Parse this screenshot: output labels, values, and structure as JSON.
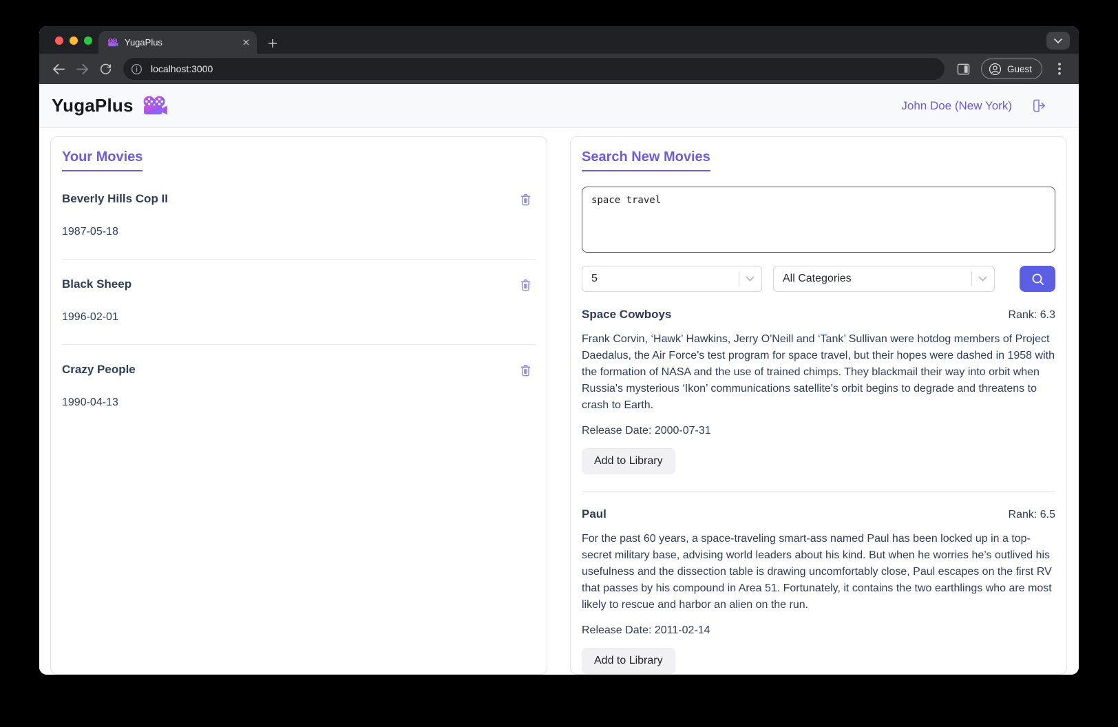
{
  "colors": {
    "accent_purple": "#6d5be0",
    "icon_purple": "#8f84ef",
    "search_button": "#5b5fe3",
    "text_dark": "#2e3d59",
    "chrome_bg": "#202124",
    "chrome_surface": "#36373b"
  },
  "browser": {
    "tab_title": "YugaPlus",
    "url": "localhost:3000",
    "guest_label": "Guest"
  },
  "header": {
    "app_title": "YugaPlus",
    "user_name": "John Doe (New York)"
  },
  "library": {
    "title": "Your Movies",
    "movies": [
      {
        "title": "Beverly Hills Cop II",
        "date": "1987-05-18"
      },
      {
        "title": "Black Sheep",
        "date": "1996-02-01"
      },
      {
        "title": "Crazy People",
        "date": "1990-04-13"
      }
    ]
  },
  "search": {
    "title": "Search New Movies",
    "query": "space travel",
    "limit_value": "5",
    "category_value": "All Categories",
    "results": [
      {
        "title": "Space Cowboys",
        "rank_label": "Rank: 6.3",
        "description": "Frank Corvin, ‘Hawk’ Hawkins, Jerry O'Neill and ‘Tank’ Sullivan were hotdog members of Project Daedalus, the Air Force's test program for space travel, but their hopes were dashed in 1958 with the formation of NASA and the use of trained chimps. They blackmail their way into orbit when Russia's mysterious ‘Ikon’ communications satellite's orbit begins to degrade and threatens to crash to Earth.",
        "release_label": "Release Date: 2000-07-31",
        "add_label": "Add to Library"
      },
      {
        "title": "Paul",
        "rank_label": "Rank: 6.5",
        "description": "For the past 60 years, a space-traveling smart-ass named Paul has been locked up in a top-secret military base, advising world leaders about his kind. But when he worries he’s outlived his usefulness and the dissection table is drawing uncomfortably close, Paul escapes on the first RV that passes by his compound in Area 51. Fortunately, it contains the two earthlings who are most likely to rescue and harbor an alien on the run.",
        "release_label": "Release Date: 2011-02-14",
        "add_label": "Add to Library"
      }
    ]
  }
}
